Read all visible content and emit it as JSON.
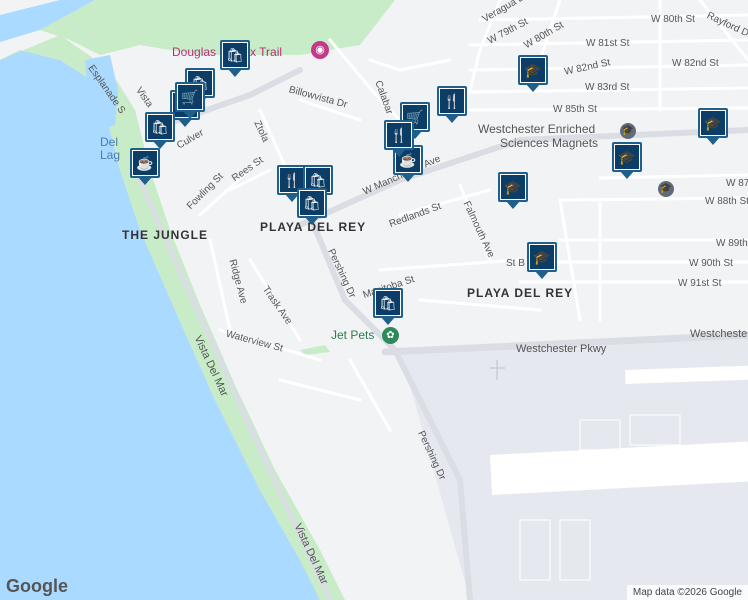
{
  "map": {
    "colors": {
      "water": "#aadaff",
      "park": "#c8ebc8",
      "land": "#f2f3f5",
      "road": "#ffffff",
      "highway": "#dadde3",
      "airport": "#e5e8ef",
      "runway": "#ffffff",
      "pin": "#0b3d66"
    },
    "street_labels": {
      "veragua": "Veragua Dr",
      "w79": "W 79th St",
      "w80_top": "W 80th St",
      "w80": "W 80th St",
      "w81": "W 81st St",
      "w82": "W 82nd St",
      "w82nd": "W 82nd St",
      "w83": "W 83rd St",
      "w85": "W 85th St",
      "w87": "W 87",
      "w88": "W 88th St",
      "w89": "W 89th",
      "w90": "W 90th St",
      "w91": "W 91st St",
      "rayford": "Rayford Dr",
      "calabar": "Calabar",
      "billowvista": "Billowvista Dr",
      "esplanade": "Esplanade S",
      "vista_top": "Vista",
      "culver": "Culver",
      "fowling": "Fowling St",
      "rees": "Rees St",
      "ztola": "Ztola",
      "manchester": "W Manchester Ave",
      "redlands": "Redlands St",
      "falmouth": "Falmouth Ave",
      "manitoba": "Manitoba St",
      "stb": "St B",
      "pershing1": "Pershing Dr",
      "pershing2": "Pershing Dr",
      "ridge": "Ridge Ave",
      "trask": "Trask Ave",
      "waterview": "Waterview St",
      "westchester": "Westchester Pkwy",
      "vdm1": "Vista Del Mar",
      "vdm2": "Vista Del Mar",
      "del1": "Del",
      "del2": "Lag"
    },
    "neighborhoods": {
      "jungle": "THE JUNGLE",
      "pdr1": "PLAYA DEL REY",
      "pdr2": "PLAYA DEL REY"
    },
    "pois": {
      "trail": "Douglas Fir Lux Trail",
      "school": "Westchester Enriched",
      "school2": "Sciences Magnets",
      "jetpets": "Jet Pets"
    },
    "pins": [
      {
        "type": "shopping",
        "icon": "🛍"
      },
      {
        "type": "shopping",
        "icon": "🛍"
      },
      {
        "type": "shopping",
        "icon": "🛍"
      },
      {
        "type": "shopping",
        "icon": "🛍"
      },
      {
        "type": "coffee",
        "icon": "☕"
      },
      {
        "type": "grocery",
        "icon": "🛒"
      },
      {
        "type": "restaurant",
        "icon": "🍴"
      },
      {
        "type": "coffee",
        "icon": "☕"
      },
      {
        "type": "grocery",
        "icon": "🛒"
      },
      {
        "type": "restaurant",
        "icon": "🍴"
      },
      {
        "type": "school",
        "icon": "🎓"
      },
      {
        "type": "school",
        "icon": "🎓"
      },
      {
        "type": "school",
        "icon": "🎓"
      },
      {
        "type": "school",
        "icon": "🎓"
      },
      {
        "type": "school",
        "icon": "🎓"
      },
      {
        "type": "restaurant",
        "icon": "🍴"
      },
      {
        "type": "shopping",
        "icon": "🛍"
      },
      {
        "type": "shopping",
        "icon": "🛍"
      },
      {
        "type": "shopping",
        "icon": "🛍"
      }
    ],
    "google_logo": "Google",
    "attribution": "Map data ©2026 Google"
  }
}
